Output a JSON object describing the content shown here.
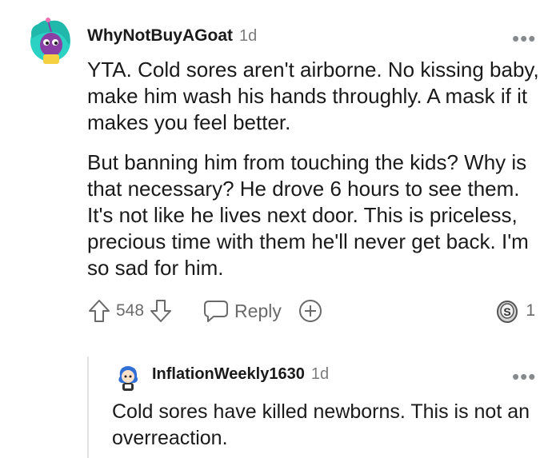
{
  "comment": {
    "username": "WhyNotBuyAGoat",
    "age": "1d",
    "more_label": "•••",
    "paragraphs": [
      "YTA. Cold sores aren't airborne. No kissing baby, make him wash his hands throughly. A mask if it makes you feel better.",
      "But banning him from touching the kids? Why is that necessary? He drove 6 hours to see them. It's not like he lives next door. This is priceless, precious time with them he'll never get back. I'm so sad for him."
    ],
    "upvote_count": "548",
    "reply_label": "Reply",
    "award_count": "1",
    "colors": {
      "avatar_bg": "#2bd1c3",
      "avatar_face": "#8a3fa5",
      "avatar_shirt": "#f5d142"
    }
  },
  "reply": {
    "username": "InflationWeekly1630",
    "age": "1d",
    "more_label": "•••",
    "text": "Cold sores have killed newborns. This is not an overreaction.",
    "colors": {
      "avatar_hair": "#2f6fd6"
    }
  },
  "icons": {
    "upvote": "upvote-arrow-icon",
    "downvote": "downvote-arrow-icon",
    "reply": "chat-bubble-icon",
    "add_award": "plus-circle-icon",
    "award": "silver-award-icon"
  }
}
